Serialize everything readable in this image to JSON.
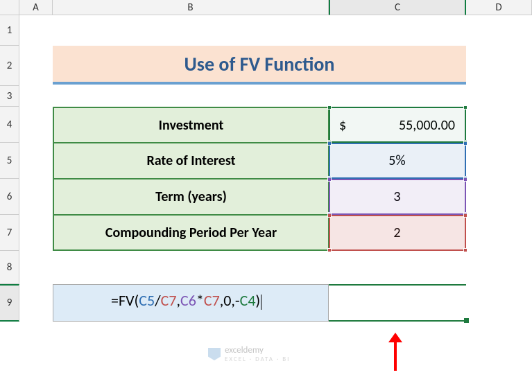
{
  "columns": {
    "A": "A",
    "B": "B",
    "C": "C",
    "D": "D"
  },
  "rows": {
    "1": "1",
    "2": "2",
    "3": "3",
    "4": "4",
    "5": "5",
    "6": "6",
    "7": "7",
    "8": "8",
    "9": "9"
  },
  "title": "Use of FV Function",
  "table": {
    "rows": [
      {
        "label": "Investment",
        "value_prefix": "$",
        "value": "55,000.00"
      },
      {
        "label": "Rate of Interest",
        "value": "5%"
      },
      {
        "label": "Term (years)",
        "value": "3"
      },
      {
        "label": "Compounding Period Per Year",
        "value": "2"
      }
    ]
  },
  "formula": {
    "prefix": "=FV(",
    "ref1": "C5",
    "op1": "/",
    "ref2": "C7",
    "sep1": ",",
    "ref3": "C6",
    "op2": "*",
    "ref4": "C7",
    "sep2": ",0,-",
    "ref5": "C4",
    "suffix": ")"
  },
  "watermark": {
    "name": "exceldemy",
    "tagline": "EXCEL · DATA · BI"
  },
  "chart_data": {
    "type": "table",
    "title": "Use of FV Function",
    "rows": [
      {
        "label": "Investment",
        "value": 55000.0,
        "format": "currency_usd"
      },
      {
        "label": "Rate of Interest",
        "value": 0.05,
        "format": "percent"
      },
      {
        "label": "Term (years)",
        "value": 3
      },
      {
        "label": "Compounding Period Per Year",
        "value": 2
      }
    ],
    "formula_cell": "=FV(C5/C7,C6*C7,0,-C4)"
  }
}
